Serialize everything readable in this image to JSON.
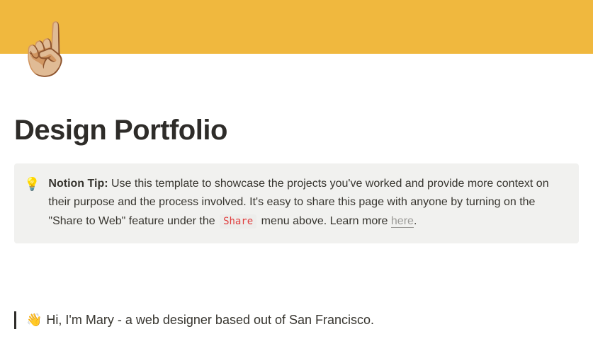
{
  "cover": {
    "color": "#f0b83e",
    "icon": "☝🏼"
  },
  "title": "Design Portfolio",
  "callout": {
    "icon": "💡",
    "bold_label": "Notion Tip:",
    "text_before_code": " Use this template to showcase the projects you've worked and provide more context on their purpose and the process involved. It's easy to share this page with anyone by turning on the \"Share to Web\" feature under the ",
    "code": "Share",
    "text_after_code": " menu above. Learn more ",
    "link_text": "here",
    "period": "."
  },
  "quote": {
    "emoji": "👋",
    "text": "Hi, I'm Mary - a web designer based out of San Francisco."
  }
}
